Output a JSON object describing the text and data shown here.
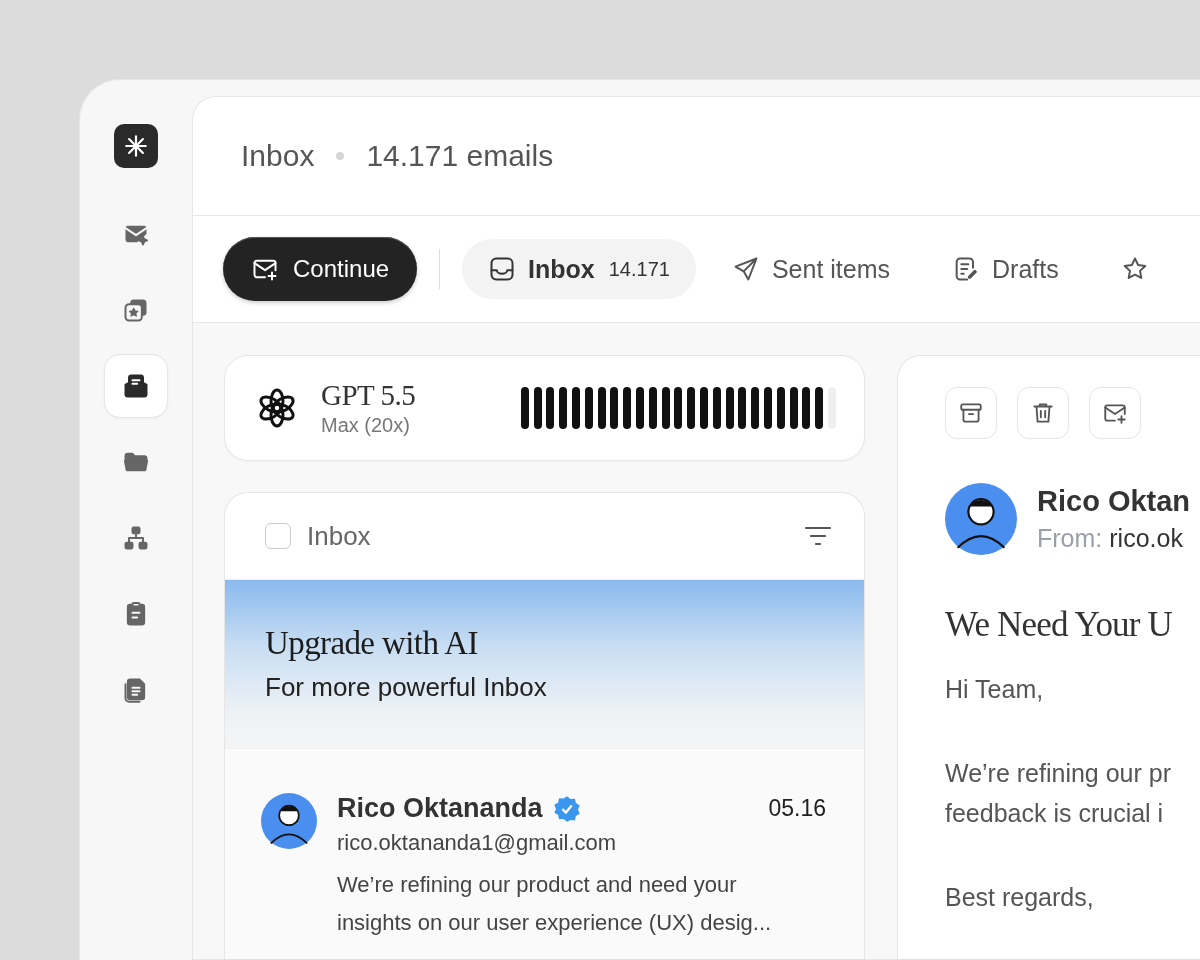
{
  "sidebar": {
    "items": [
      {
        "kind": "mail-sparkle",
        "selected": false
      },
      {
        "kind": "star-stack",
        "selected": false
      },
      {
        "kind": "inbox-tray",
        "selected": true
      },
      {
        "kind": "folder",
        "selected": false
      },
      {
        "kind": "hierarchy",
        "selected": false
      },
      {
        "kind": "clipboard",
        "selected": false
      },
      {
        "kind": "document",
        "selected": false
      }
    ]
  },
  "header": {
    "title": "Inbox",
    "count": "14.171 emails"
  },
  "toolbar": {
    "primary_button": "Continue",
    "tabs": [
      {
        "kind": "inbox",
        "label": "Inbox",
        "count": "14.171",
        "selected": true
      },
      {
        "kind": "sent",
        "label": "Sent items",
        "selected": false
      },
      {
        "kind": "drafts",
        "label": "Drafts",
        "selected": false
      },
      {
        "kind": "starred",
        "selected": false
      }
    ]
  },
  "plan_card": {
    "model": "GPT 5.5",
    "plan": "Max (20x)",
    "level": 0.96
  },
  "mail_list": {
    "title": "Inbox",
    "select_all_checked": false,
    "banner": {
      "title": "Upgrade with AI",
      "subtitle": "For more powerful Inbox"
    },
    "emails": [
      {
        "sender": "Rico Oktananda",
        "verified": true,
        "time": "05.16",
        "address": "rico.oktananda1@gmail.com",
        "preview": "We’re refining our product and need your insights on our user experience (UX) desig..."
      }
    ]
  },
  "message": {
    "actions": [
      {
        "kind": "archive"
      },
      {
        "kind": "delete"
      },
      {
        "kind": "compose"
      }
    ],
    "sender": "Rico Oktan",
    "from_label": "From:",
    "from_address": "rico.ok",
    "subject": "We Need Your U",
    "paragraphs": [
      {
        "lines": [
          "Hi Team,"
        ]
      },
      {
        "lines": [
          "We’re refining our pr",
          "feedback is crucial i"
        ]
      },
      {
        "lines": [
          "Best regards,"
        ]
      }
    ]
  }
}
